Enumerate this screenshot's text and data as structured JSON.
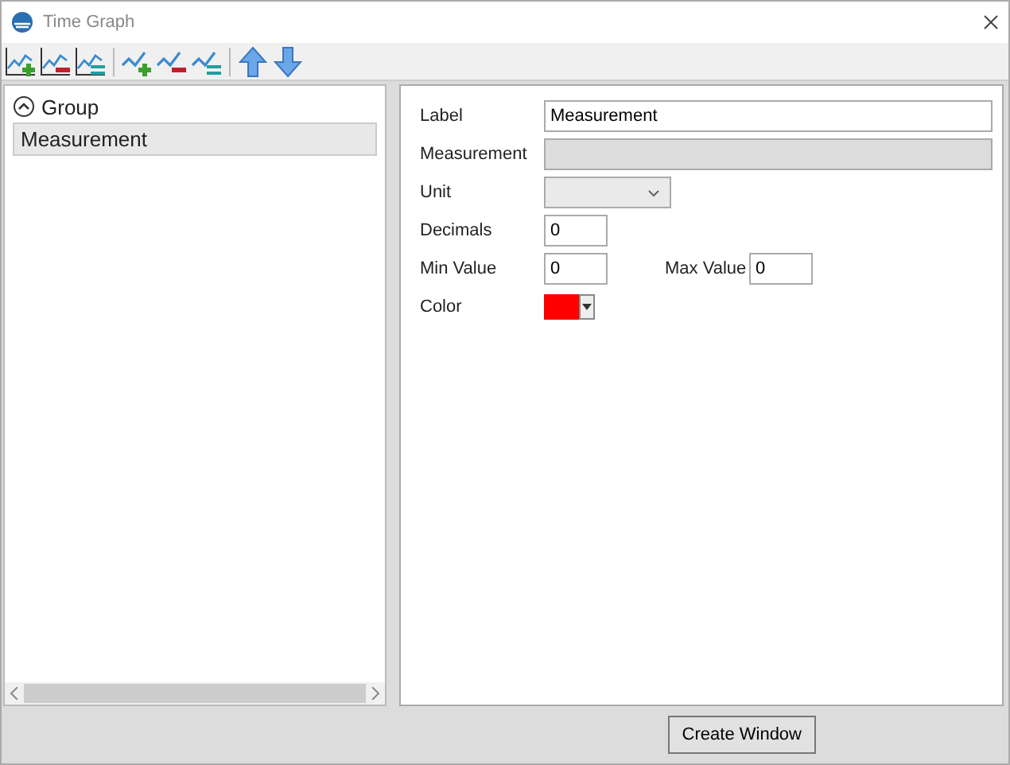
{
  "window": {
    "title": "Time Graph"
  },
  "toolbar": [
    {
      "kind": "graph-add"
    },
    {
      "kind": "graph-remove"
    },
    {
      "kind": "graph-edit"
    },
    {
      "kind": "sep"
    },
    {
      "kind": "line-add"
    },
    {
      "kind": "line-remove"
    },
    {
      "kind": "line-edit"
    },
    {
      "kind": "sep"
    },
    {
      "kind": "up"
    },
    {
      "kind": "down"
    }
  ],
  "tree": [
    {
      "label": "Group",
      "expanded": true,
      "children": [
        {
          "label": "Measurement",
          "selected": true
        }
      ]
    }
  ],
  "form": [
    {
      "kind": "text",
      "label": "Label",
      "value": "Measurement"
    },
    {
      "kind": "disabled",
      "label": "Measurement"
    },
    {
      "kind": "select",
      "label": "Unit"
    },
    {
      "kind": "number",
      "label": "Decimals",
      "value": "0"
    },
    {
      "kind": "pair",
      "label": "Min Value",
      "value": "0",
      "label2": "Max Value",
      "value2": "0"
    },
    {
      "kind": "color",
      "label": "Color",
      "color": "#ff0000"
    }
  ],
  "buttons": [
    "Create Window"
  ]
}
